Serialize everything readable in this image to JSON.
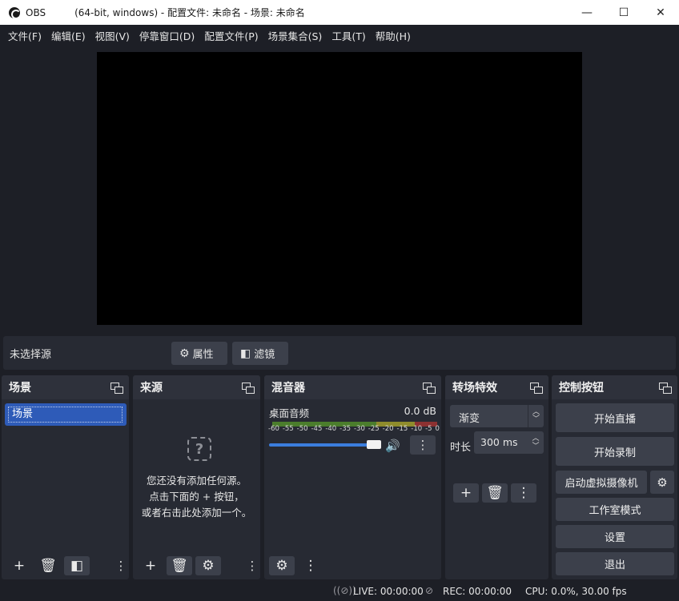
{
  "window": {
    "app_name": "OBS",
    "title": "(64-bit, windows) - 配置文件: 未命名 - 场景: 未命名",
    "minimize_glyph": "—",
    "maximize_glyph": "☐",
    "close_glyph": "✕"
  },
  "menu": [
    "文件(F)",
    "编辑(E)",
    "视图(V)",
    "停靠窗口(D)",
    "配置文件(P)",
    "场景集合(S)",
    "工具(T)",
    "帮助(H)"
  ],
  "source_bar": {
    "no_source": "未选择源",
    "properties_label": "属性",
    "filters_label": "滤镜",
    "properties_icon": "gear-icon",
    "filters_icon": "filter-icon"
  },
  "scenes": {
    "title": "场景",
    "items": [
      "场景"
    ]
  },
  "sources": {
    "title": "来源",
    "empty_icon": "?",
    "empty_line1": "您还没有添加任何源。",
    "empty_line2": "点击下面的 + 按钮，",
    "empty_line3": "或者右击此处添加一个。"
  },
  "mixer": {
    "title": "混音器",
    "channel_name": "桌面音频",
    "level": "0.0 dB",
    "volume_fraction": 1.0,
    "scale": [
      "-60",
      "-55",
      "-50",
      "-45",
      "-40",
      "-35",
      "-30",
      "-25",
      "-20",
      "-15",
      "-10",
      "-5",
      "0"
    ]
  },
  "transitions": {
    "title": "转场特效",
    "selected": "渐变",
    "duration_label": "时长",
    "duration_value": "300 ms"
  },
  "controls": {
    "title": "控制按钮",
    "start_streaming": "开始直播",
    "start_recording": "开始录制",
    "start_virtual_cam": "启动虚拟摄像机",
    "studio_mode": "工作室模式",
    "settings": "设置",
    "exit": "退出"
  },
  "status": {
    "live": "LIVE: 00:00:00",
    "rec": "REC: 00:00:00",
    "cpu": "CPU: 0.0%, 30.00 fps"
  },
  "colors": {
    "accent": "#2e5bb8",
    "slider": "#3b7ddd",
    "background": "#1d1f26",
    "panel": "#272a33",
    "button": "#3c404b"
  }
}
